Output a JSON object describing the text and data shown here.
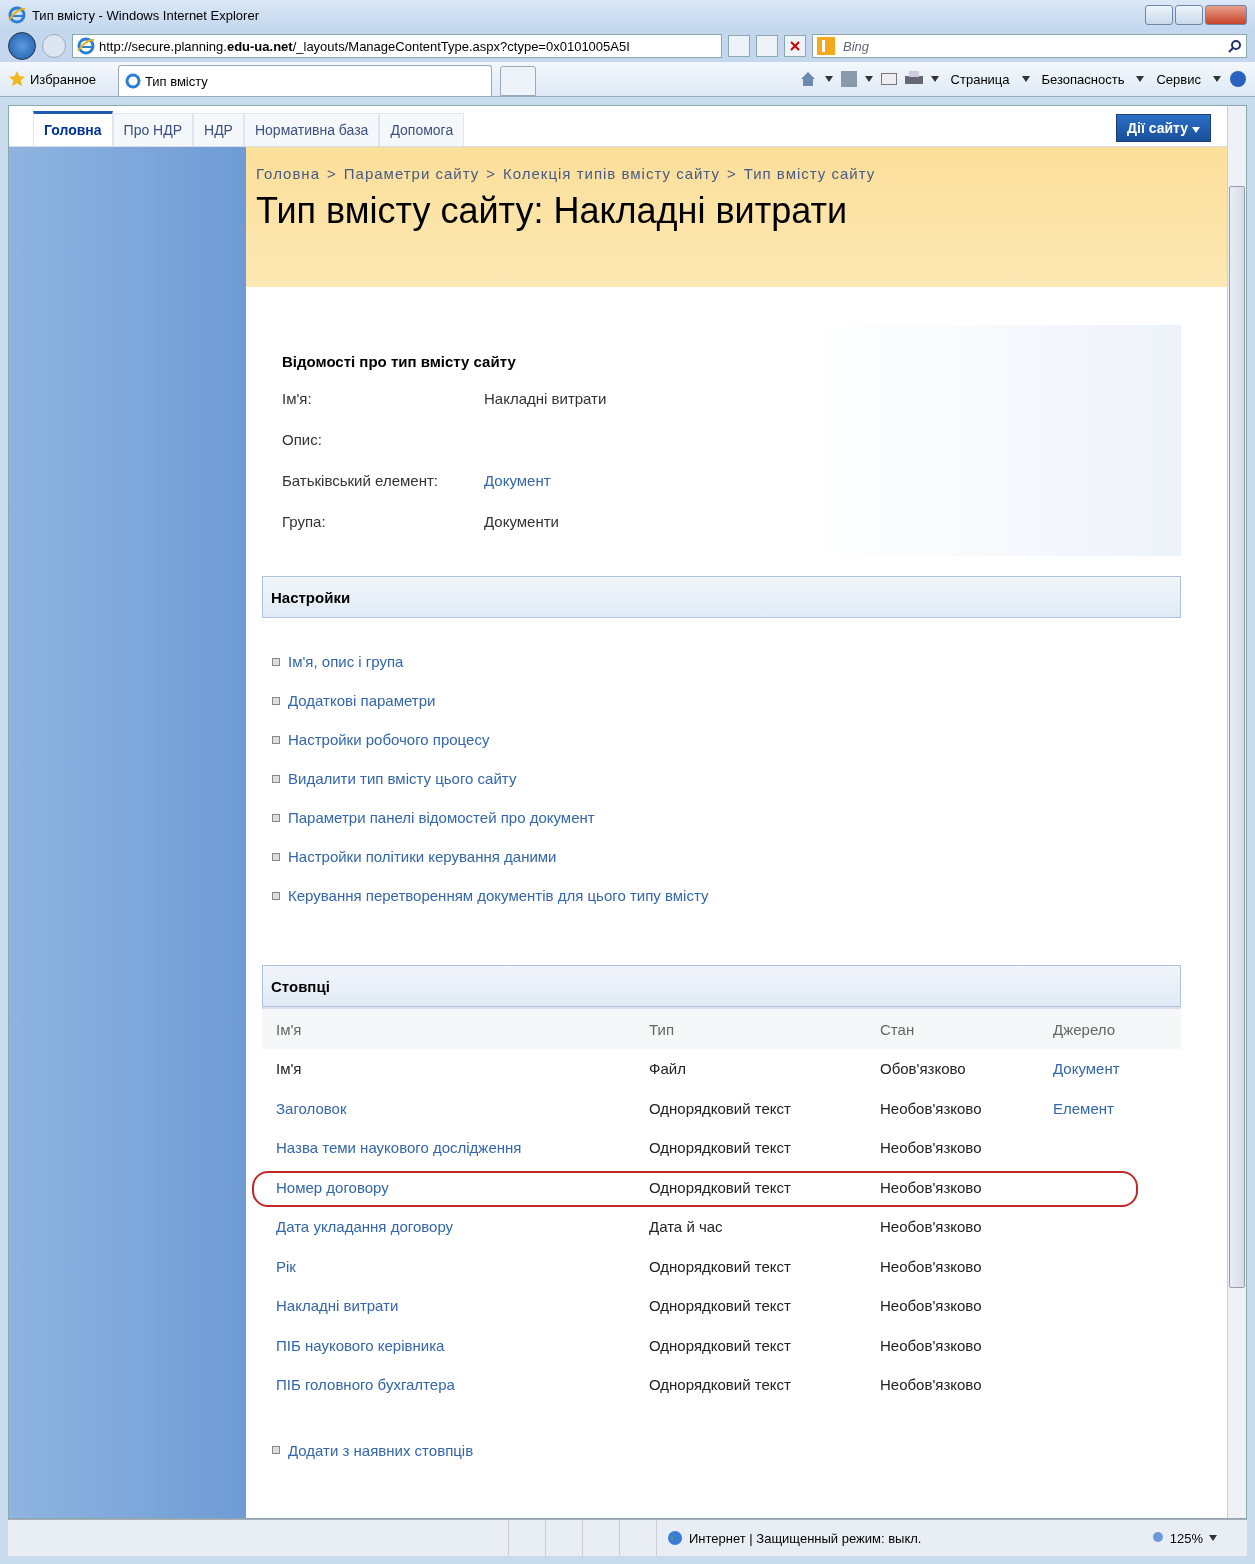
{
  "window": {
    "title": "Тип вмісту - Windows Internet Explorer"
  },
  "address_bar": {
    "url_prefix": "http://secure.planning.",
    "url_domain": "edu-ua.net",
    "url_rest": "/_layouts/ManageContentType.aspx?ctype=0x0101005A5I"
  },
  "search": {
    "placeholder": "Bing"
  },
  "favorites_bar": {
    "favorites": "Избранное",
    "tab": "Тип вмісту"
  },
  "command_bar": [
    "Страница",
    "Безопасность",
    "Сервис"
  ],
  "site_tabs": [
    {
      "label": "Головна",
      "selected": true
    },
    {
      "label": "Про НДР",
      "selected": false
    },
    {
      "label": "НДР",
      "selected": false
    },
    {
      "label": "Нормативна база",
      "selected": false
    },
    {
      "label": "Допомога",
      "selected": false
    }
  ],
  "site_actions": "Дії сайту",
  "breadcrumb": [
    "Головна",
    "Параметри сайту",
    "Колекція типів вмісту сайту",
    "Тип вмісту сайту"
  ],
  "breadcrumb_separator": ">",
  "page_title": "Тип вмісту сайту: Накладні витрати",
  "info": {
    "heading": "Відомості про тип вмісту сайту",
    "fields": [
      {
        "label": "Ім'я:",
        "value": "Накладні витрати",
        "link": false
      },
      {
        "label": "Опис:"
      },
      {
        "label": "Батьківський елемент:",
        "value": "Документ",
        "link": true
      },
      {
        "label": "Група:",
        "value": "Документи",
        "link": false
      }
    ]
  },
  "settings": {
    "heading": "Настройки",
    "links": [
      "Ім'я, опис і група",
      "Додаткові параметри",
      "Настройки робочого процесу",
      "Видалити тип вмісту цього сайту",
      "Параметри панелі відомостей про документ",
      "Настройки політики керування даними",
      "Керування перетворенням документів для цього типу вмісту"
    ]
  },
  "columns": {
    "heading": "Стовпці",
    "headers": [
      "Ім'я",
      "Тип",
      "Стан",
      "Джерело"
    ],
    "rows": [
      {
        "name": "Ім'я",
        "link": false,
        "type": "Файл",
        "status": "Обов'язково",
        "source": "Документ",
        "circled": false
      },
      {
        "name": "Заголовок",
        "link": true,
        "type": "Однорядковий текст",
        "status": "Необов'язково",
        "source": "Елемент",
        "circled": false
      },
      {
        "name": "Назва теми наукового дослідження",
        "link": true,
        "type": "Однорядковий текст",
        "status": "Необов'язково",
        "circled": false
      },
      {
        "name": "Номер договору",
        "link": true,
        "type": "Однорядковий текст",
        "status": "Необов'язково",
        "circled": true
      },
      {
        "name": "Дата укладання договору",
        "link": true,
        "type": "Дата й час",
        "status": "Необов'язково",
        "circled": false
      },
      {
        "name": "Рік",
        "link": true,
        "type": "Однорядковий текст",
        "status": "Необов'язково",
        "circled": false
      },
      {
        "name": "Накладні витрати",
        "link": true,
        "type": "Однорядковий текст",
        "status": "Необов'язково",
        "circled": false
      },
      {
        "name": "ПІБ наукового керівника",
        "link": true,
        "type": "Однорядковий текст",
        "status": "Необов'язково",
        "circled": false
      },
      {
        "name": "ПІБ головного бухгалтера",
        "link": true,
        "type": "Однорядковий текст",
        "status": "Необов'язково",
        "circled": false
      }
    ],
    "add_link": "Додати з наявних стовпців"
  },
  "status_bar": {
    "zone": "Интернет | Защищенный режим: выкл.",
    "zoom": "125%"
  }
}
